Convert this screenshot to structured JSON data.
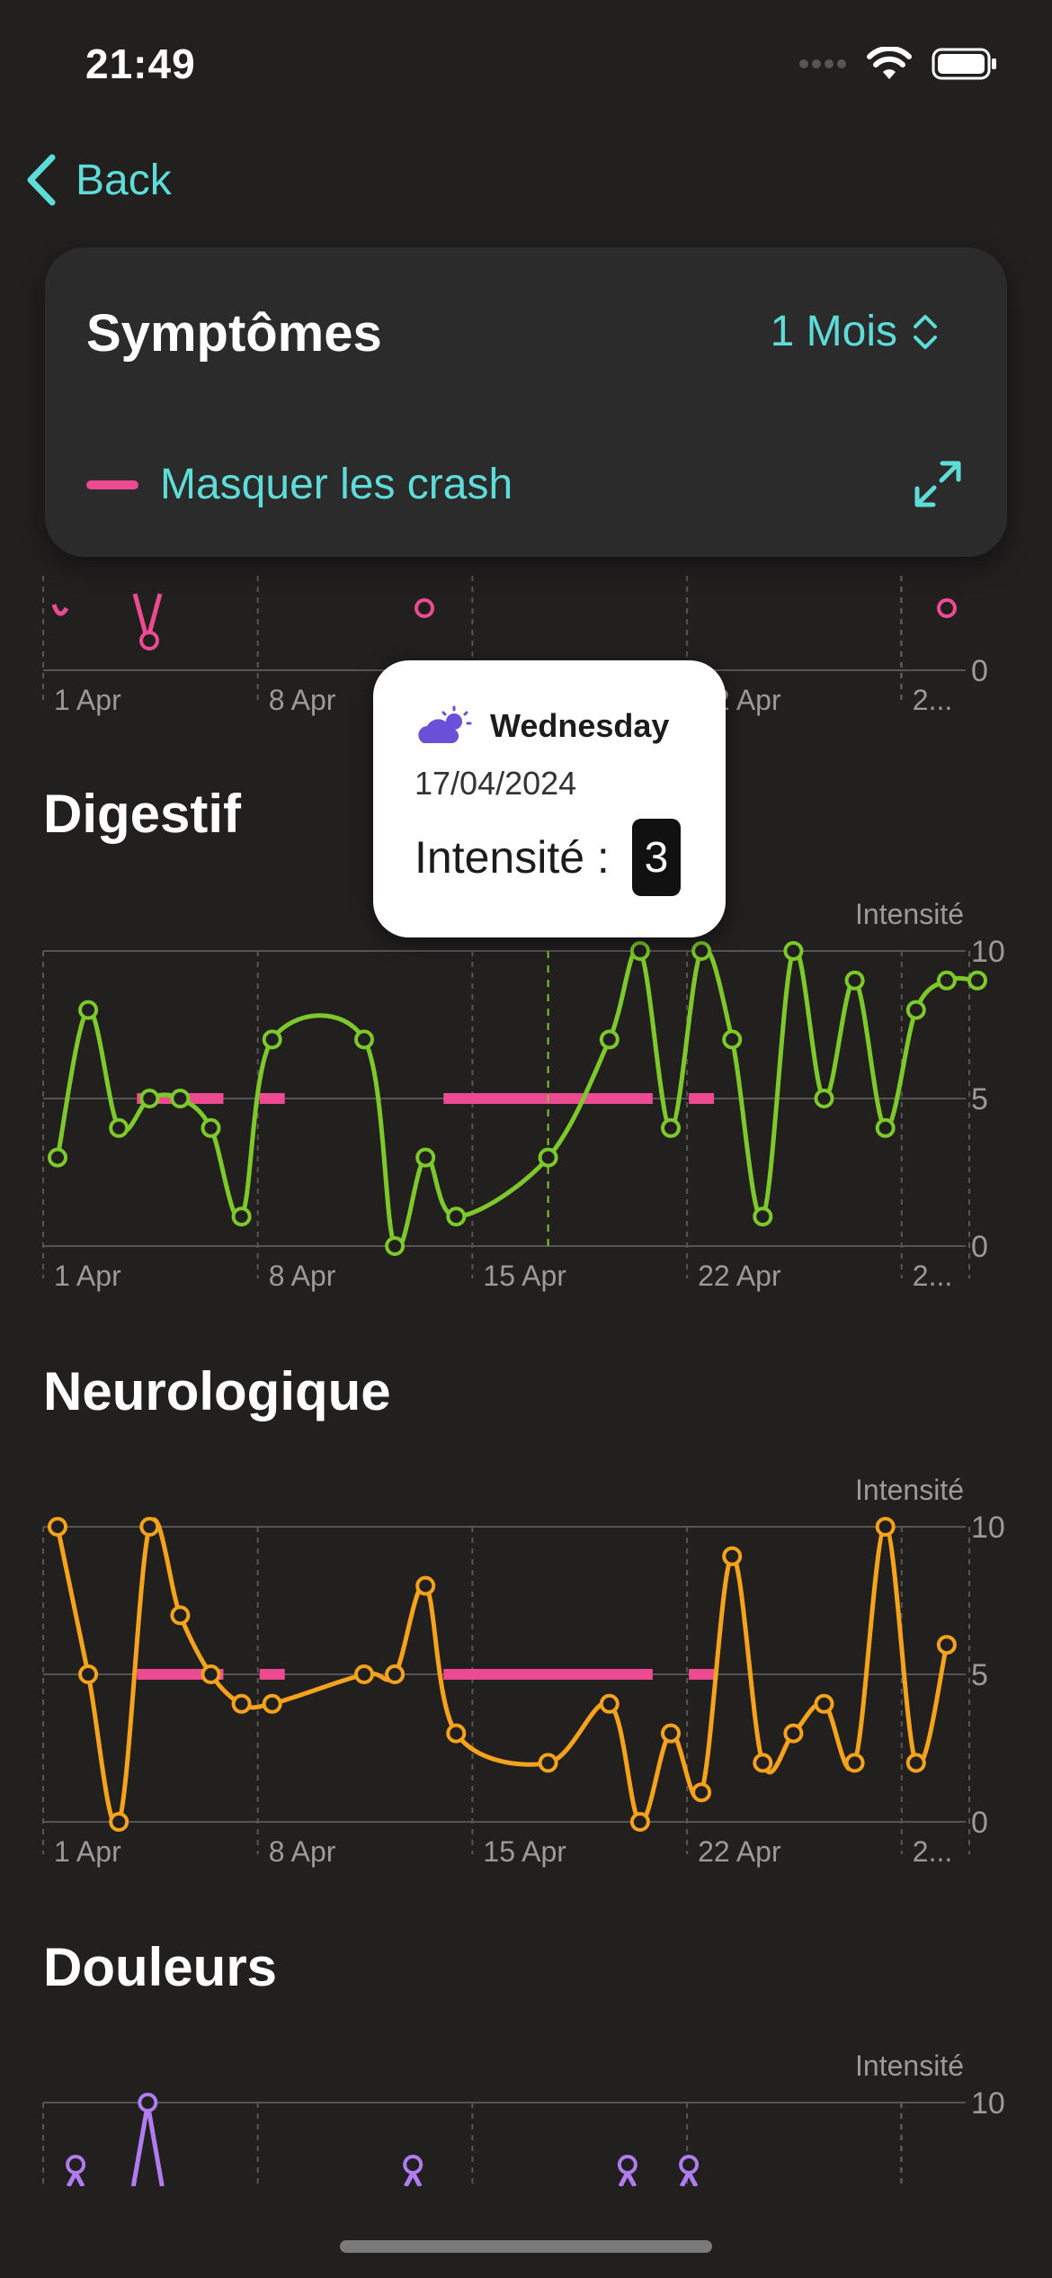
{
  "status_bar": {
    "time": "21:49"
  },
  "nav": {
    "back_label": "Back"
  },
  "filter_card": {
    "title": "Symptômes",
    "period": "1 Mois",
    "crash_toggle_label": "Masquer les crash",
    "colors": {
      "accent": "#5ddcd8",
      "crash": "#ec4b91",
      "card": "#2b2b2b"
    }
  },
  "tooltip": {
    "day": "Wednesday",
    "date": "17/04/2024",
    "label": "Intensité :",
    "value": "3",
    "icon": "partly-cloudy-day-icon"
  },
  "sections": {
    "digestif": "Digestif",
    "neurologique": "Neurologique",
    "douleurs": "Douleurs"
  },
  "chart_data": [
    {
      "type": "line",
      "title": "",
      "x_ticks": [
        "1 Apr",
        "8 Apr",
        "15 Apr",
        "22 Apr",
        "2..."
      ],
      "y_ticks": [
        "0"
      ],
      "color": "#ec4b91",
      "note_visible_partial": true,
      "x": [
        1,
        4,
        13,
        30
      ],
      "values": [
        0,
        0,
        0,
        0
      ]
    },
    {
      "type": "line",
      "title": "Digestif",
      "ylabel": "Intensité",
      "y_ticks": [
        "0",
        "5",
        "10"
      ],
      "ylim": [
        0,
        10
      ],
      "x_ticks": [
        "1 Apr",
        "8 Apr",
        "15 Apr",
        "22 Apr",
        "2..."
      ],
      "color": "#7dc82a",
      "x": [
        1,
        2,
        3,
        4,
        5,
        6,
        7,
        8,
        11,
        12,
        13,
        14,
        17,
        19,
        20,
        21,
        22,
        23,
        24,
        25,
        26,
        27,
        28,
        29,
        30,
        31
      ],
      "values": [
        3,
        8,
        4,
        5,
        5,
        4,
        1,
        7,
        7,
        0,
        3,
        1,
        3,
        7,
        10,
        4,
        10,
        7,
        1,
        10,
        5,
        9,
        4,
        8,
        9,
        9
      ],
      "crash_ranges": [
        [
          4,
          6
        ],
        [
          8,
          8
        ],
        [
          14,
          20
        ],
        [
          22,
          22
        ]
      ],
      "selected_x": 17
    },
    {
      "type": "line",
      "title": "Neurologique",
      "ylabel": "Intensité",
      "y_ticks": [
        "0",
        "5",
        "10"
      ],
      "ylim": [
        0,
        10
      ],
      "x_ticks": [
        "1 Apr",
        "8 Apr",
        "15 Apr",
        "22 Apr",
        "2..."
      ],
      "color": "#f5a21d",
      "x": [
        1,
        2,
        3,
        4,
        5,
        6,
        7,
        8,
        11,
        12,
        13,
        14,
        17,
        19,
        20,
        21,
        22,
        23,
        24,
        25,
        26,
        27,
        28,
        29,
        30
      ],
      "values": [
        10,
        5,
        0,
        10,
        7,
        5,
        4,
        4,
        5,
        5,
        8,
        3,
        2,
        4,
        0,
        3,
        1,
        9,
        2,
        3,
        4,
        2,
        10,
        2,
        6
      ],
      "crash_ranges": [
        [
          4,
          6
        ],
        [
          8,
          8
        ],
        [
          14,
          20
        ],
        [
          22,
          22
        ]
      ]
    },
    {
      "type": "line",
      "title": "Douleurs",
      "ylabel": "Intensité",
      "y_ticks": [
        "10"
      ],
      "ylim": [
        0,
        10
      ],
      "color": "#b07cf0",
      "x": [
        2,
        4,
        13,
        20,
        22
      ],
      "values": [
        7,
        10,
        7,
        7,
        7
      ]
    }
  ]
}
